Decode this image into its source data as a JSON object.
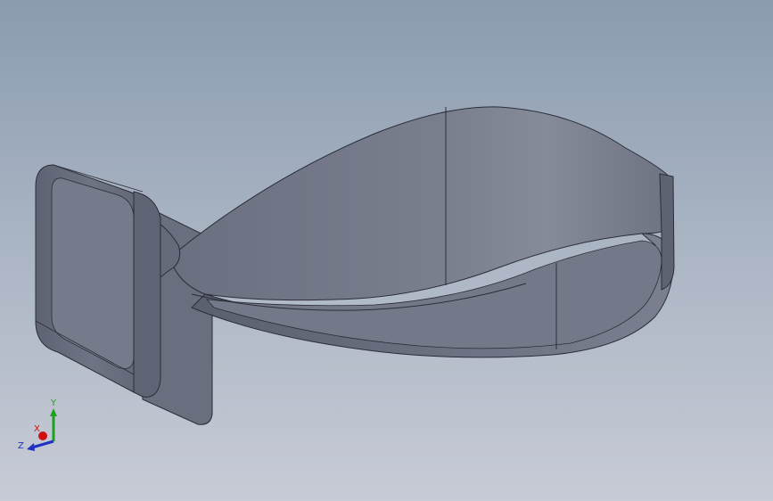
{
  "viewport": {
    "background_top": "#8a9bb0",
    "background_bottom": "#c7cbd6",
    "model": {
      "icon": "clip-part-icon",
      "fill_color": "#6f7585",
      "edge_color": "#2b2e38"
    }
  },
  "triad": {
    "x_label": "X",
    "y_label": "Y",
    "z_label": "Z",
    "x_color": "#d01010",
    "y_color": "#20a020",
    "z_color": "#2030c0"
  }
}
